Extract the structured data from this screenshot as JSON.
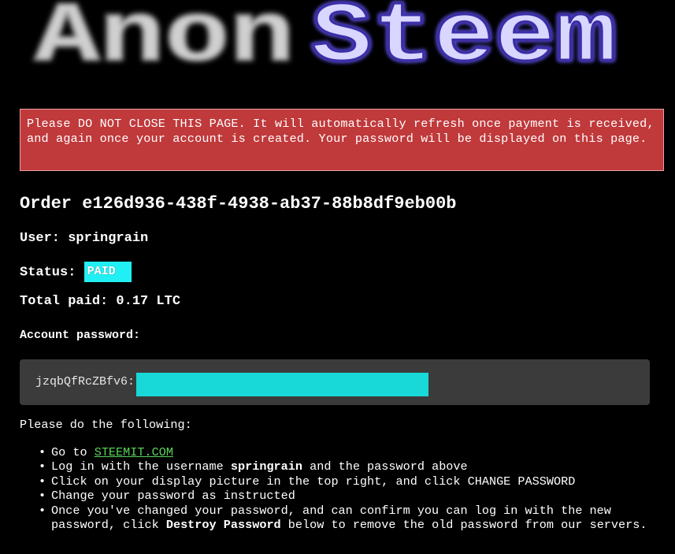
{
  "logo": {
    "word1": "Anon",
    "word2": "Steem"
  },
  "warning": {
    "text": "Please DO NOT CLOSE THIS PAGE. It will automatically refresh once payment is received, and again once your account is created. Your password will be displayed on this page."
  },
  "order": {
    "title": "Order e126d936-438f-4938-ab37-88b8df9eb00b"
  },
  "user": {
    "label": "User:",
    "value": "springrain"
  },
  "status": {
    "label": "Status:",
    "value": "PAID"
  },
  "total": {
    "label": "Total paid:",
    "value": "0.17 LTC"
  },
  "password": {
    "label": "Account password:",
    "value": "jzqbQfRcZBfv6:"
  },
  "instructions": {
    "intro": "Please do the following:",
    "step1_prefix": "Go to",
    "step1_link": "STEEMIT.COM",
    "step2_prefix": "Log in with the username",
    "step2_username": "springrain",
    "step2_suffix": "and the password above",
    "step3": "Click on your display picture in the top right, and click CHANGE PASSWORD",
    "step4": "Change your password as instructed",
    "step5_prefix": "Once you've changed your password, and can confirm you can log in with the new password, click",
    "step5_bold": "Destroy Password",
    "step5_suffix": "below to remove the old password from our servers.",
    "bullet": "•"
  },
  "colors": {
    "background": "#000000",
    "warning_bg": "#c0393b",
    "status_badge_bg": "#20f0f4",
    "redaction": "#18d9d8",
    "password_box_bg": "#3b3b3b",
    "link": "#5bd45b",
    "logo_steem_fill": "#d9d6ff",
    "logo_steem_glow": "#5a4fd8"
  }
}
